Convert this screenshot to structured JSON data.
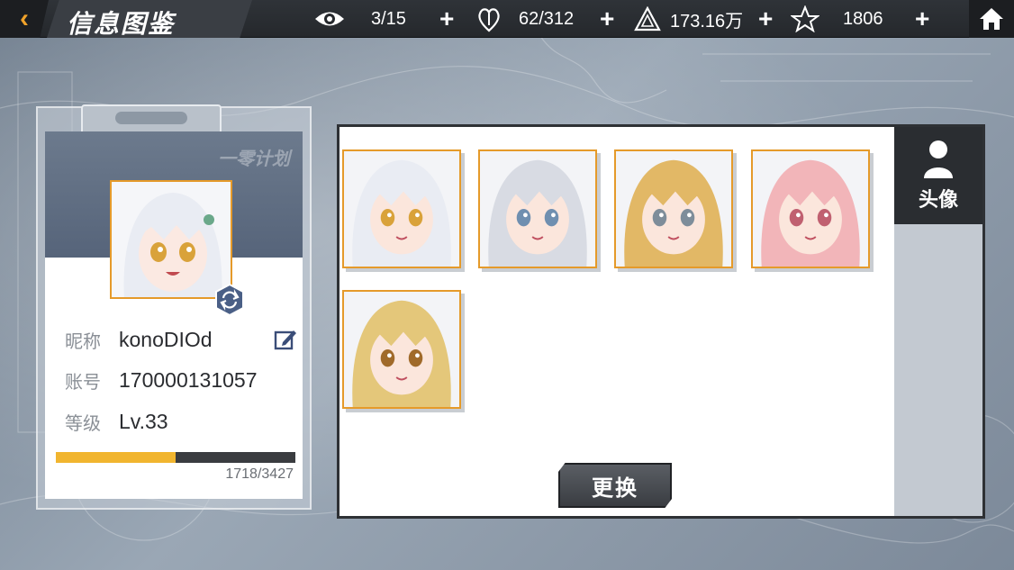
{
  "header": {
    "title": "信息图鉴",
    "resources": [
      {
        "icon": "eye-icon",
        "value": "3/15"
      },
      {
        "icon": "heart-icon",
        "value": "62/312"
      },
      {
        "icon": "pyramid-icon",
        "value": "173.16万"
      },
      {
        "icon": "star-icon",
        "value": "1806"
      }
    ]
  },
  "profile": {
    "nickname_label": "昵称",
    "nickname": "konoDIOd",
    "account_label": "账号",
    "account": "170000131057",
    "level_label": "等级",
    "level": "Lv.33",
    "exp_text": "1718/3427",
    "exp_fraction": 0.5013
  },
  "panel": {
    "side_tab_label": "头像",
    "avatars": [
      {
        "name": "avatar-option-1",
        "hair": "#e9ecf3",
        "eyes": "#d9a23a",
        "selected": true
      },
      {
        "name": "avatar-option-2",
        "hair": "#d8dbe3",
        "eyes": "#6f8fb0",
        "selected": false
      },
      {
        "name": "avatar-option-3",
        "hair": "#e2b866",
        "eyes": "#7e8d9a",
        "selected": false
      },
      {
        "name": "avatar-option-4",
        "hair": "#f2b5b9",
        "eyes": "#c06070",
        "selected": false
      },
      {
        "name": "avatar-option-5",
        "hair": "#e4c77a",
        "eyes": "#a06a2a",
        "selected": false
      }
    ],
    "change_label": "更换"
  },
  "colors": {
    "accent": "#e59a2a",
    "exp_bar": "#f1b52f"
  }
}
